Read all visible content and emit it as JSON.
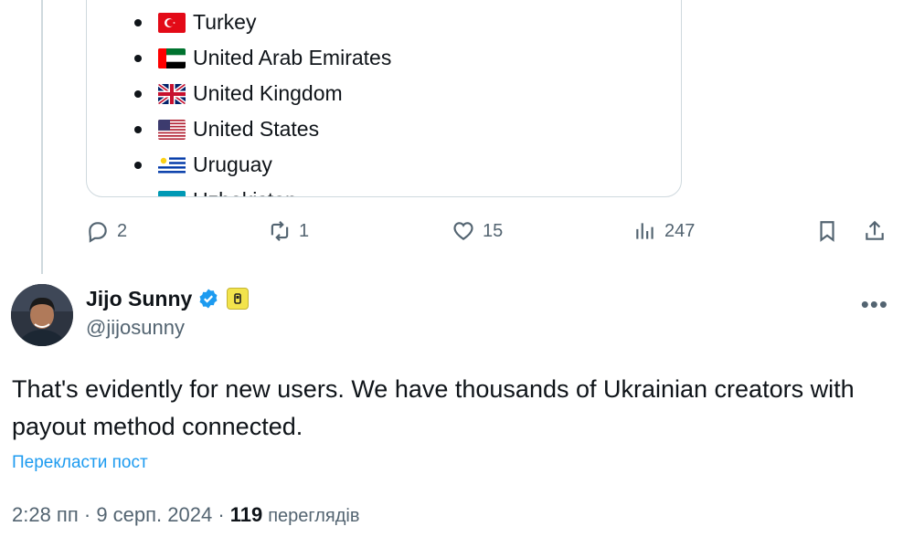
{
  "quoted_card": {
    "countries": [
      {
        "name": "Turkey",
        "flag": "turkey-flag-icon"
      },
      {
        "name": "United Arab Emirates",
        "flag": "uae-flag-icon"
      },
      {
        "name": "United Kingdom",
        "flag": "uk-flag-icon"
      },
      {
        "name": "United States",
        "flag": "us-flag-icon"
      },
      {
        "name": "Uruguay",
        "flag": "uruguay-flag-icon"
      },
      {
        "name": "Uzbekistan",
        "flag": "uzbekistan-flag-icon"
      }
    ]
  },
  "action_bar": {
    "replies": "2",
    "reposts": "1",
    "likes": "15",
    "views": "247"
  },
  "post": {
    "author_name": "Jijo Sunny",
    "author_handle": "@jijosunny",
    "text": "That's evidently for new users. We have thousands of Ukrainian creators with payout method connected.",
    "translate_label": "Перекласти пост",
    "time": "2:28 пп",
    "date": "9 серп. 2024",
    "views_count": "119",
    "views_label": "переглядів"
  },
  "colors": {
    "accent": "#1d9bf0",
    "text_secondary": "#536471",
    "border": "#cfd9de"
  }
}
